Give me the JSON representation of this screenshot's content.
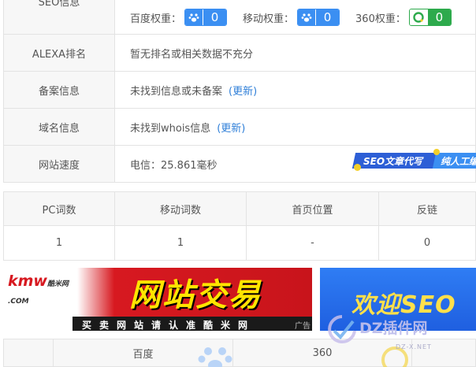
{
  "info_rows": [
    {
      "label": "SEO信息"
    },
    {
      "label": "ALEXA排名",
      "value": "暂无排名或相关数据不充分"
    },
    {
      "label": "备案信息",
      "value": "未找到信息或未备案",
      "link": "(更新)"
    },
    {
      "label": "域名信息",
      "value": "未找到whois信息",
      "link": "(更新)"
    },
    {
      "label": "网站速度",
      "value": "电信：25.861毫秒"
    }
  ],
  "weights": [
    {
      "label": "百度权重：",
      "value": "0",
      "icon": "baidu-paw-icon",
      "color": "#3b8ff2"
    },
    {
      "label": "移动权重：",
      "value": "0",
      "icon": "baidu-paw-icon",
      "color": "#3b8ff2"
    },
    {
      "label": "360权重：",
      "value": "0",
      "icon": "360-icon",
      "color": "#2daa4c"
    }
  ],
  "seo_ad": {
    "part1": "SEO文章代写",
    "part2": "纯人工编辑"
  },
  "words_table": {
    "headers": [
      "PC词数",
      "移动词数",
      "首页位置",
      "反链"
    ],
    "row": [
      "1",
      "1",
      "-",
      "0"
    ]
  },
  "banner_kmw": {
    "logo": "kmw",
    "logo_cn": "酷米网",
    "logo_sub": ".COM",
    "headline": "网站交易",
    "slogan": "买卖网站请认准酷米网",
    "ad_tag": "广告"
  },
  "banner_seo": {
    "headline": "欢迎SEO"
  },
  "watermark": {
    "text": "DZ插件网",
    "sub": "DZ-X.NET"
  },
  "bottom_table": {
    "headers": [
      "",
      "百度",
      "360",
      ""
    ]
  },
  "colors": {
    "link": "#2f7fd8",
    "baidu": "#3b8ff2",
    "so360": "#2daa4c",
    "accent": "#f3cf28"
  }
}
